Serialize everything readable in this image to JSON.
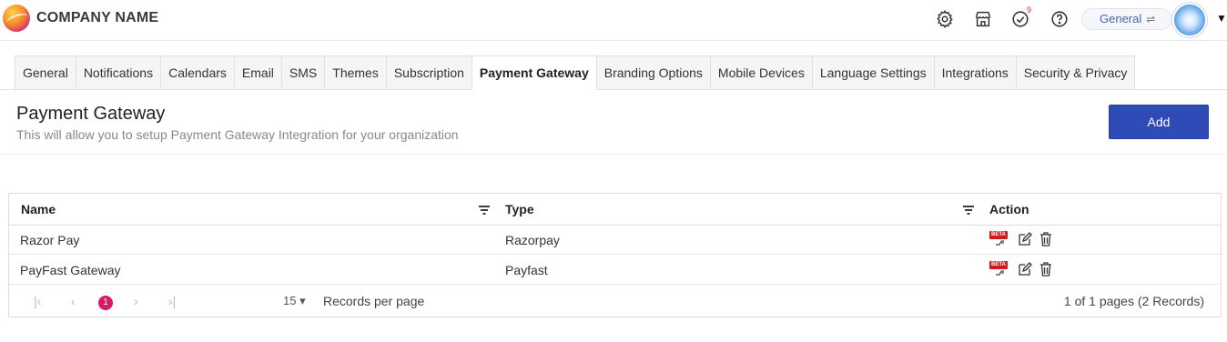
{
  "header": {
    "company_name": "COMPANY NAME",
    "notification_count": "9",
    "workspace_label": "General",
    "icons": [
      "gear-icon",
      "store-icon",
      "task-check-icon",
      "help-icon",
      "swap-icon",
      "chevron-down-icon"
    ]
  },
  "tabs": [
    {
      "label": "General"
    },
    {
      "label": "Notifications"
    },
    {
      "label": "Calendars"
    },
    {
      "label": "Email"
    },
    {
      "label": "SMS"
    },
    {
      "label": "Themes"
    },
    {
      "label": "Subscription"
    },
    {
      "label": "Payment Gateway",
      "active": true
    },
    {
      "label": "Branding Options"
    },
    {
      "label": "Mobile Devices"
    },
    {
      "label": "Language Settings"
    },
    {
      "label": "Integrations"
    },
    {
      "label": "Security & Privacy"
    }
  ],
  "section": {
    "title": "Payment Gateway",
    "subtitle": "This will allow you to setup Payment Gateway Integration for your organization",
    "add_label": "Add"
  },
  "grid": {
    "columns": [
      "Name",
      "Type",
      "Action"
    ],
    "rows": [
      {
        "name": "Razor Pay",
        "type": "Razorpay"
      },
      {
        "name": "PayFast Gateway",
        "type": "Payfast"
      }
    ],
    "beta_tag": "BETA",
    "pager": {
      "current_page": "1",
      "page_size": "15",
      "records_label": "Records per page",
      "info": "1 of 1 pages (2 Records)"
    }
  },
  "colors": {
    "primary": "#2e4bb8",
    "pager_active": "#d81b60",
    "beta": "#d3191c"
  }
}
